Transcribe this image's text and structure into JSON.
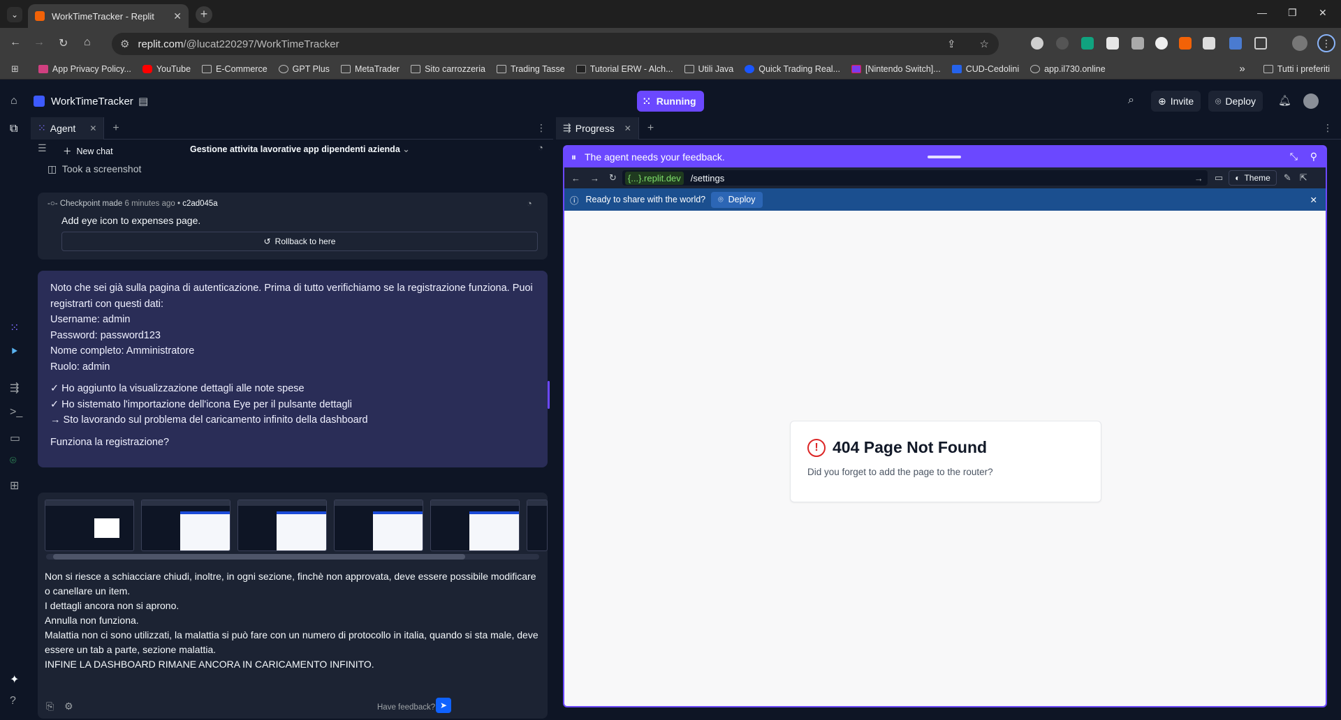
{
  "browser": {
    "tab_title": "WorkTimeTracker - Replit",
    "url_domain": "replit.com",
    "url_path": "/@lucat220297/WorkTimeTracker",
    "bookmarks": [
      "App Privacy Policy...",
      "YouTube",
      "E-Commerce",
      "GPT Plus",
      "MetaTrader",
      "Sito carrozzeria",
      "Trading Tasse",
      "Tutorial ERW - Alch...",
      "Utili Java",
      "Quick Trading Real...",
      "[Nintendo Switch]...",
      "CUD-Cedolini",
      "app.il730.online"
    ],
    "bookmarks_overflow": "»",
    "all_bookmarks": "Tutti i preferiti"
  },
  "replit": {
    "project_name": "WorkTimeTracker",
    "run_label": "Running",
    "invite_label": "Invite",
    "deploy_label": "Deploy"
  },
  "agent_panel": {
    "tab_label": "Agent",
    "new_chat": "New chat",
    "chat_title": "Gestione attivita lavorative app dipendenti azienda",
    "screenshot_label": "Took a screenshot",
    "checkpoint": {
      "prefix": "Checkpoint made",
      "time": "6 minutes ago",
      "hash": "c2ad045a",
      "description": "Add eye icon to expenses page.",
      "rollback_label": "Rollback to here"
    },
    "message_lines": [
      "Noto che sei già sulla pagina di autenticazione. Prima di tutto verifichiamo se la registrazione funziona. Puoi registrarti con questi dati:",
      "Username: admin",
      "Password: password123",
      "Nome completo: Amministratore",
      "Ruolo: admin"
    ],
    "message_checks": [
      "✓ Ho aggiunto la visualizzazione dettagli alle note spese",
      "✓ Ho sistemato l'importazione dell'icona Eye per il pulsante dettagli",
      "→ Sto lavorando sul problema del caricamento infinito della dashboard"
    ],
    "message_question": "Funziona la registrazione?",
    "compose_lines": [
      "Non si riesce a schiacciare chiudi, inoltre, in ogni sezione, finchè non approvata, deve essere possibile modificare o canellare un item.",
      "I dettagli ancora non si aprono.",
      "Annulla non funziona.",
      "Malattia non ci sono utilizzati, la malattia si può fare con un numero di protocollo in italia, quando si sta male, deve essere un tab a parte, sezione malattia.",
      "INFINE LA DASHBOARD RIMANE ANCORA IN CARICAMENTO INFINITO."
    ],
    "feedback_label": "Have feedback?"
  },
  "progress_panel": {
    "tab_label": "Progress",
    "feedback_banner": "The agent needs your feedback.",
    "web_domain": "{...}.replit.dev",
    "web_path": "/settings",
    "theme_label": "Theme",
    "share_text": "Ready to share with the world?",
    "share_deploy": "Deploy",
    "not_found_title": "404 Page Not Found",
    "not_found_text": "Did you forget to add the page to the router?"
  },
  "colors": {
    "accent": "#6b48ff",
    "background": "#0e1525",
    "surface": "#1c2333",
    "deploy_bar": "#1b4f8f",
    "error": "#dc2626"
  }
}
